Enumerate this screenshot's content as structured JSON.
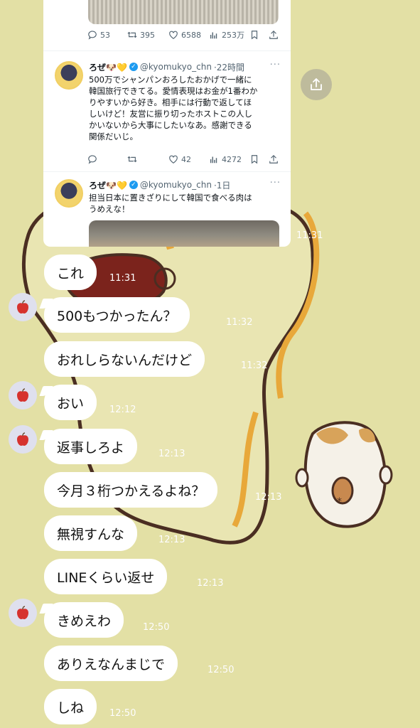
{
  "colors": {
    "background": "#e3e0a5",
    "bubble": "#ffffff",
    "timestamp": "#ffffff"
  },
  "tweet_top": {
    "stats": {
      "replies": "53",
      "retweets": "395",
      "likes": "6588",
      "views": "253万"
    }
  },
  "tweets": [
    {
      "name": "ろぜ🐶💛",
      "handle": "@kyomukyo_chn",
      "time": "·22時間",
      "more": "···",
      "body_lines": [
        "500万でシャンパンおろしたおかげで一緒に",
        "韓国旅行できてる。愛情表現はお金が1番わか",
        "りやすいから好き。相手には行動で返してほ",
        "しいけど！友営に振り切ったホストこの人し",
        "かいないから大事にしたいなあ。感謝できる",
        "関係だいじ。"
      ],
      "stats": {
        "likes": "42",
        "views": "4272"
      }
    },
    {
      "name": "ろぜ🐶💛",
      "handle": "@kyomukyo_chn",
      "time": "·1日",
      "more": "···",
      "body_lines": [
        "担当日本に置きざりにして韓国で食べる肉は",
        "うめえな！"
      ]
    }
  ],
  "card_timestamp": "11:31",
  "messages": [
    {
      "text": "これ",
      "time": "11:31"
    },
    {
      "text": "500もつかったん？",
      "time": "11:32"
    },
    {
      "text": "おれしらないんだけど",
      "time": "11:32"
    },
    {
      "text": "おい",
      "time": "12:12"
    },
    {
      "text": "返事しろよ",
      "time": "12:13"
    },
    {
      "text": "今月３桁つかえるよね？",
      "time": "12:13"
    },
    {
      "text": "無視すんな",
      "time": "12:13"
    },
    {
      "text": "LINEくらい返せ",
      "time": "12:13"
    },
    {
      "text": "きめえわ",
      "time": "12:50"
    },
    {
      "text": "ありえなんまじで",
      "time": "12:50"
    },
    {
      "text": "しね",
      "time": "12:50"
    }
  ]
}
